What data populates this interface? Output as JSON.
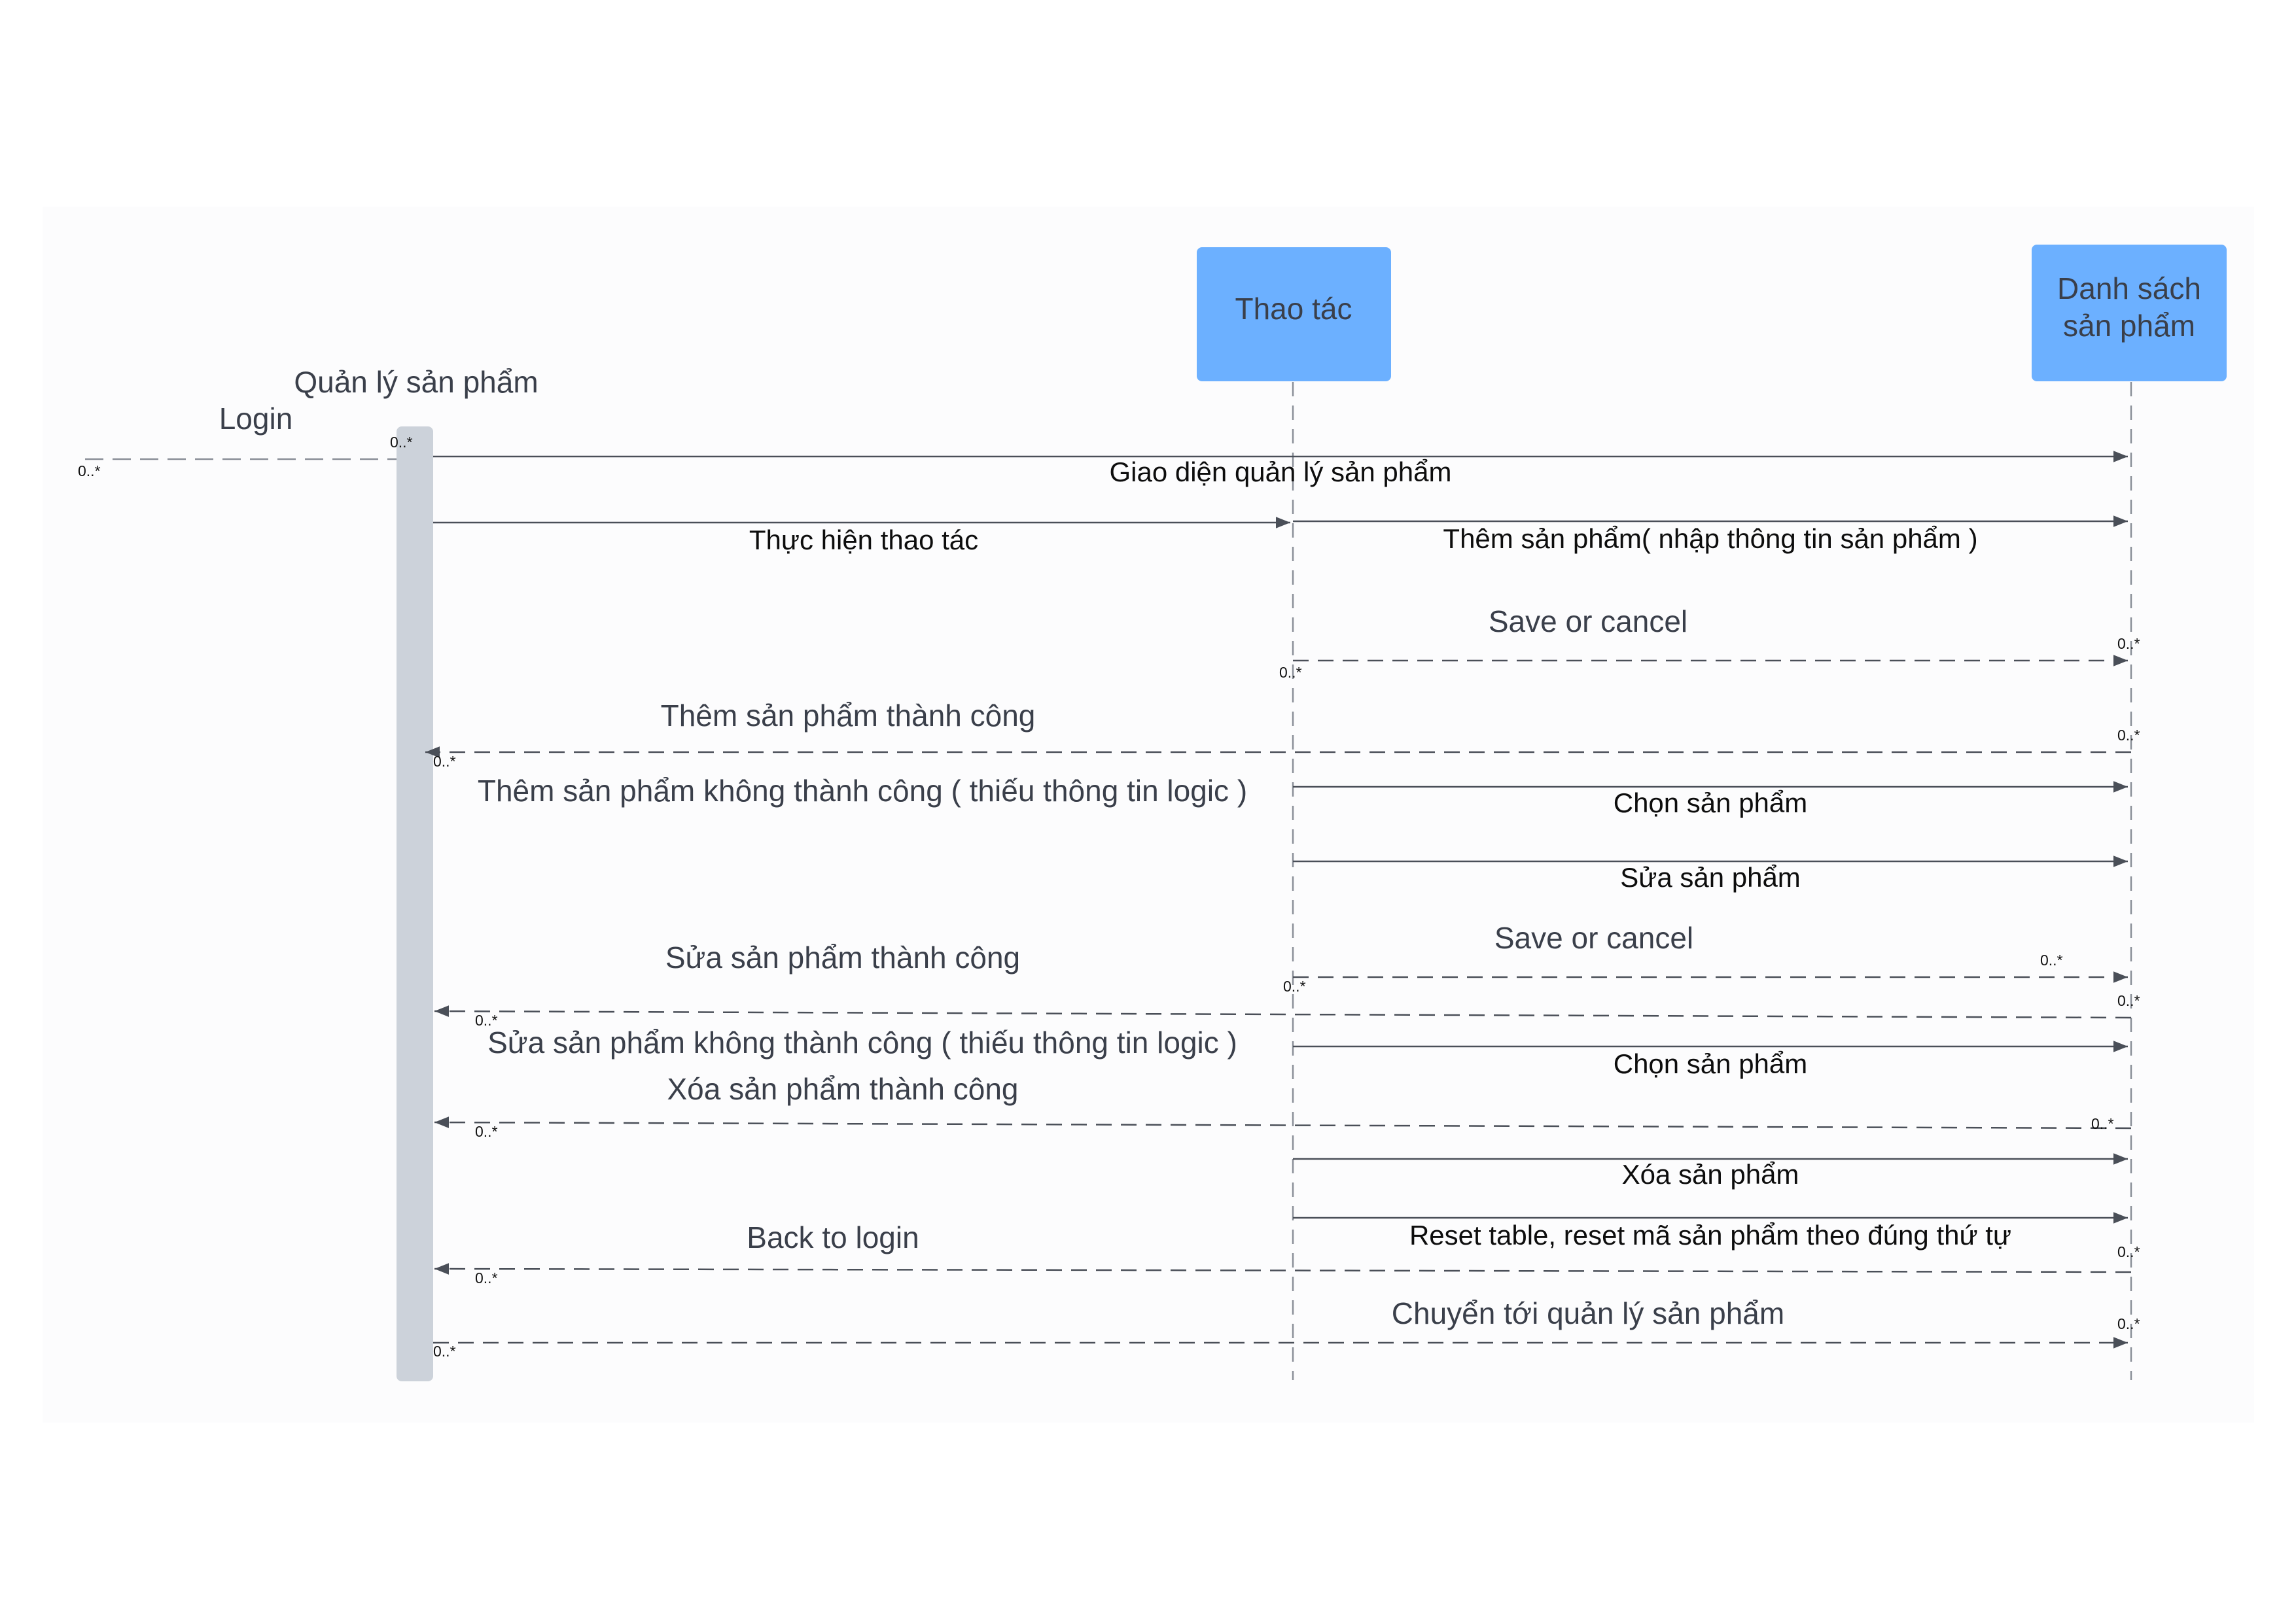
{
  "participants": {
    "quan_ly": "Quản lý sản phẩm",
    "login": "Login",
    "thao_tac": "Thao tác",
    "danh_sach_line1": "Danh sách",
    "danh_sach_line2": "sản phẩm"
  },
  "multiplicity": "0..*",
  "messages": [
    {
      "id": "m1",
      "text": "Giao diện quản lý sản phẩm",
      "from": "quan_ly",
      "to": "danh_sach",
      "style": "solid"
    },
    {
      "id": "m2",
      "text": "Thực hiện thao tác",
      "from": "quan_ly",
      "to": "thao_tac",
      "style": "solid"
    },
    {
      "id": "m3",
      "text": "Thêm sản phẩm( nhập thông tin sản phẩm )",
      "from": "thao_tac",
      "to": "danh_sach",
      "style": "solid"
    },
    {
      "id": "m4",
      "text": "Save or cancel",
      "from": "thao_tac",
      "to": "danh_sach",
      "style": "dashed"
    },
    {
      "id": "m5",
      "text": "Thêm sản phẩm thành công",
      "from": "danh_sach",
      "to": "quan_ly",
      "style": "dashed"
    },
    {
      "id": "m6",
      "text": "Thêm sản phẩm không thành công ( thiếu thông tin logic )",
      "from": "danh_sach",
      "to": "quan_ly",
      "style": "dashed"
    },
    {
      "id": "m7",
      "text": "Chọn sản phẩm",
      "from": "thao_tac",
      "to": "danh_sach",
      "style": "solid"
    },
    {
      "id": "m8",
      "text": "Sửa sản phẩm",
      "from": "thao_tac",
      "to": "danh_sach",
      "style": "solid"
    },
    {
      "id": "m9",
      "text": "Save or cancel",
      "from": "thao_tac",
      "to": "danh_sach",
      "style": "dashed"
    },
    {
      "id": "m10",
      "text": "Sửa sản phẩm thành công",
      "from": "danh_sach",
      "to": "quan_ly",
      "style": "dashed"
    },
    {
      "id": "m11",
      "text": "Sửa sản phẩm không thành công ( thiếu thông tin logic )",
      "from": "danh_sach",
      "to": "quan_ly",
      "style": "dashed"
    },
    {
      "id": "m12",
      "text": "Chọn sản phẩm",
      "from": "thao_tac",
      "to": "danh_sach",
      "style": "solid"
    },
    {
      "id": "m13",
      "text": "Xóa sản phẩm thành công",
      "from": "danh_sach",
      "to": "quan_ly",
      "style": "dashed"
    },
    {
      "id": "m14",
      "text": "Xóa sản phẩm",
      "from": "thao_tac",
      "to": "danh_sach",
      "style": "solid"
    },
    {
      "id": "m15",
      "text": "Reset table, reset mã sản phẩm theo đúng thứ tự",
      "from": "thao_tac",
      "to": "danh_sach",
      "style": "solid"
    },
    {
      "id": "m16",
      "text": "Back to login",
      "from": "danh_sach",
      "to": "quan_ly",
      "style": "dashed"
    },
    {
      "id": "m17",
      "text": "Chuyển tới quản lý sản phẩm",
      "from": "quan_ly",
      "to": "danh_sach",
      "style": "dashed"
    }
  ],
  "colors": {
    "participant_box": "#6cb0ff",
    "activation_bar": "#ccd2da",
    "lifeline": "#8a8f98",
    "arrow": "#4a4f58",
    "canvas": "#fcfcfd"
  }
}
